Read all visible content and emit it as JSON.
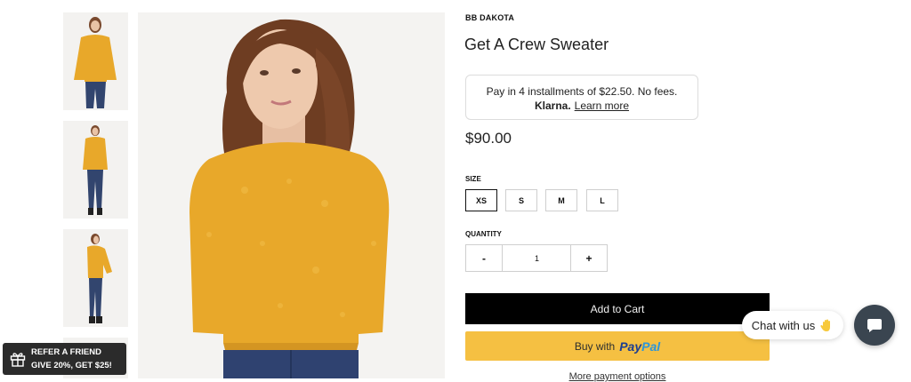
{
  "product": {
    "brand": "BB DAKOTA",
    "title": "Get A Crew Sweater",
    "price": "$90.00"
  },
  "klarna": {
    "installment_text": "Pay in 4 installments of $22.50. No fees.",
    "logo_text": "Klarna.",
    "link_text": "Learn more"
  },
  "size": {
    "label": "SIZE",
    "options": [
      "XS",
      "S",
      "M",
      "L"
    ],
    "selected": "XS"
  },
  "quantity": {
    "label": "QUANTITY",
    "minus": "-",
    "value": "1",
    "plus": "+"
  },
  "buttons": {
    "add_to_cart": "Add to Cart",
    "paypal_prefix": "Buy with",
    "paypal_pay": "Pay",
    "paypal_pal": "Pal",
    "more_options": "More payment options"
  },
  "chat": {
    "bubble_text": "Chat with us",
    "launcher_icon": "chat-icon"
  },
  "referral": {
    "line1": "REFER A FRIEND",
    "line2": "GIVE 20%, GET $25!",
    "icon": "gift-icon"
  },
  "colors": {
    "accent_black": "#000000",
    "paypal_yellow": "#f5c042",
    "sweater": "#e8a82a",
    "chat_launcher": "#3a4550"
  }
}
